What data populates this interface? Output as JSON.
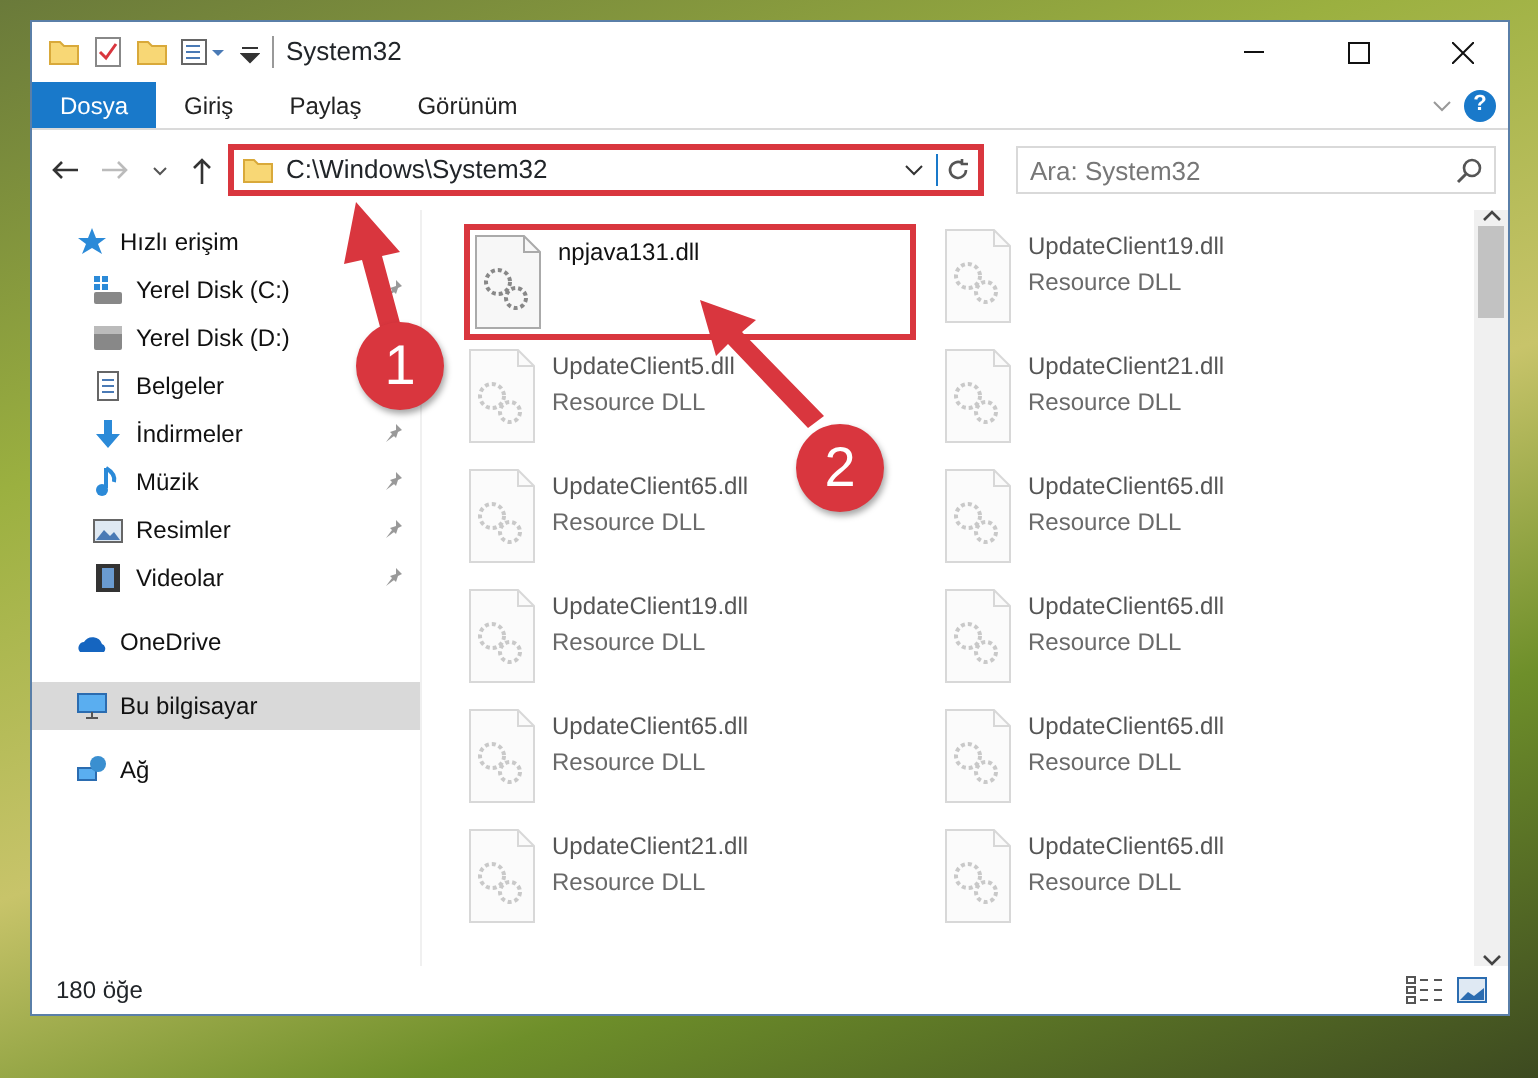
{
  "window": {
    "title": "System32"
  },
  "ribbon": {
    "tabs": [
      {
        "label": "Dosya",
        "kind": "file"
      },
      {
        "label": "Giriş",
        "kind": "tab"
      },
      {
        "label": "Paylaş",
        "kind": "tab"
      },
      {
        "label": "Görünüm",
        "kind": "tab"
      }
    ],
    "help": "?"
  },
  "address_bar": {
    "path": "C:\\Windows\\System32",
    "highlighted": true
  },
  "search": {
    "placeholder": "Ara: System32"
  },
  "sidebar": {
    "items": [
      {
        "label": "Hızlı erişim",
        "kind": "star",
        "selected": false,
        "pinned": false,
        "children": [
          {
            "label": "Yerel Disk (C:)",
            "kind": "drive-win",
            "selected": false,
            "pinned": true
          },
          {
            "label": "Yerel Disk (D:)",
            "kind": "drive",
            "selected": false,
            "pinned": false
          },
          {
            "label": "Belgeler",
            "kind": "documents",
            "selected": false,
            "pinned": false
          },
          {
            "label": "İndirmeler",
            "kind": "download",
            "selected": false,
            "pinned": true
          },
          {
            "label": "Müzik",
            "kind": "music",
            "selected": false,
            "pinned": true
          },
          {
            "label": "Resimler",
            "kind": "pictures",
            "selected": false,
            "pinned": true
          },
          {
            "label": "Videolar",
            "kind": "videos",
            "selected": false,
            "pinned": true
          }
        ]
      },
      {
        "label": "OneDrive",
        "kind": "cloud",
        "selected": false,
        "pinned": false
      },
      {
        "label": "Bu bilgisayar",
        "kind": "computer",
        "selected": true,
        "pinned": false
      },
      {
        "label": "Ağ",
        "kind": "network",
        "selected": false,
        "pinned": false
      }
    ]
  },
  "files": [
    {
      "name": "npjava131.dll",
      "highlighted": true,
      "blurred": false
    },
    {
      "name": "UpdateClient19.dll",
      "type": "Resource DLL",
      "highlighted": false,
      "blurred": true
    },
    {
      "name": "UpdateClient5.dll",
      "type": "Resource DLL",
      "highlighted": false,
      "blurred": true
    },
    {
      "name": "UpdateClient21.dll",
      "type": "Resource DLL",
      "highlighted": false,
      "blurred": true
    },
    {
      "name": "UpdateClient65.dll",
      "type": "Resource DLL",
      "highlighted": false,
      "blurred": true
    },
    {
      "name": "UpdateClient65.dll",
      "type": "Resource DLL",
      "highlighted": false,
      "blurred": true
    },
    {
      "name": "UpdateClient19.dll",
      "type": "Resource DLL",
      "highlighted": false,
      "blurred": true
    },
    {
      "name": "UpdateClient65.dll",
      "type": "Resource DLL",
      "highlighted": false,
      "blurred": true
    },
    {
      "name": "UpdateClient65.dll",
      "type": "Resource DLL",
      "highlighted": false,
      "blurred": true
    },
    {
      "name": "UpdateClient65.dll",
      "type": "Resource DLL",
      "highlighted": false,
      "blurred": true
    },
    {
      "name": "UpdateClient21.dll",
      "type": "Resource DLL",
      "highlighted": false,
      "blurred": true
    },
    {
      "name": "UpdateClient65.dll",
      "type": "Resource DLL",
      "highlighted": false,
      "blurred": true
    }
  ],
  "status_bar": {
    "count": "180 öğe"
  },
  "annotations": [
    {
      "number": "1"
    },
    {
      "number": "2"
    }
  ]
}
